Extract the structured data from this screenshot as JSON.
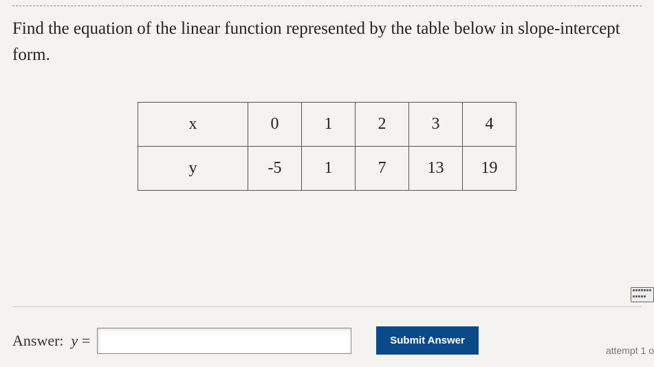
{
  "question": "Find the equation of the linear function represented by the table below in slope-intercept form.",
  "table": {
    "rowLabels": [
      "x",
      "y"
    ],
    "rows": [
      [
        "0",
        "1",
        "2",
        "3",
        "4"
      ],
      [
        "-5",
        "1",
        "7",
        "13",
        "19"
      ]
    ]
  },
  "answer": {
    "label_prefix": "Answer:",
    "variable": "y",
    "equals": "=",
    "value": "",
    "placeholder": ""
  },
  "buttons": {
    "submit": "Submit Answer"
  },
  "status": {
    "attempt": "attempt 1 o"
  },
  "chart_data": {
    "type": "table",
    "columns": [
      "x",
      "y"
    ],
    "rows": [
      {
        "x": 0,
        "y": -5
      },
      {
        "x": 1,
        "y": 1
      },
      {
        "x": 2,
        "y": 7
      },
      {
        "x": 3,
        "y": 13
      },
      {
        "x": 4,
        "y": 19
      }
    ],
    "title": "Find the equation of the linear function represented by the table below in slope-intercept form."
  }
}
